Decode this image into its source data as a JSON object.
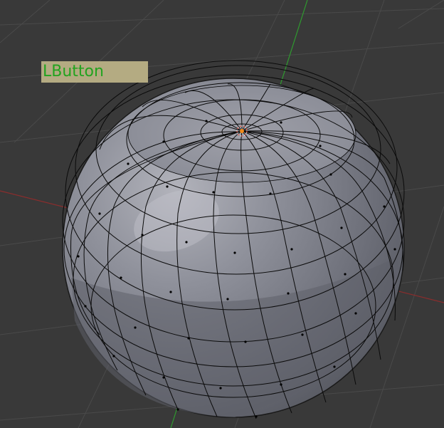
{
  "viewport": {
    "background_color": "#393939",
    "grid_color": "#4a4a4a",
    "x_axis_color": "#8a2d2d",
    "y_axis_color": "#2f9a2f",
    "mesh_object": "uv-sphere",
    "mesh_face_color": "#8c8e99",
    "mesh_wire_color": "#000000",
    "mode": "edit-mode"
  },
  "overlay": {
    "key_label": "LButton",
    "key_label_bg": "#b4ab82",
    "key_label_color": "#22a31f"
  }
}
